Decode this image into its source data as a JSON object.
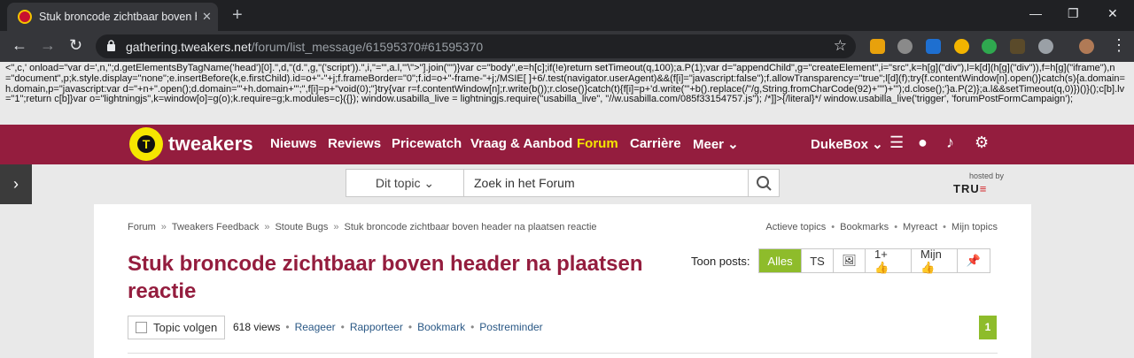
{
  "browser": {
    "tab_title": "Stuk broncode zichtbaar boven h",
    "tab_close": "✕",
    "new_tab": "+",
    "window_controls": [
      "—",
      "❐",
      "✕"
    ],
    "url_host": "gathering.tweakers.net",
    "url_path": "/forum/list_message/61595370#61595370",
    "back": "←",
    "forward": "→",
    "reload": "↻",
    "star": "☆",
    "extensions": [
      "download-icon",
      "abp-icon",
      "bookmark-icon",
      "chrome-icon",
      "translate-icon",
      "dark-icon",
      "chat-icon",
      "avatar-icon",
      "menu-icon"
    ],
    "menu": "⋮"
  },
  "leaked_code": "<\",c,' onload=\"var d=',n,\";d.getElementsByTagName('head')[0].\",d,\"(d.\",g,\"('script')).\",i,\"='\",a.l,\"'\\\">\"].join(\"\")}var c=\"body\",e=h[c];if(!e)return setTimeout(q,100);a.P(1);var d=\"appendChild\",g=\"createElement\",i=\"src\",k=h[g](\"div\"),l=k[d](h[g](\"div\")),f=h[g](\"iframe\"),n=\"document\",p;k.style.display=\"none\";e.insertBefore(k,e.firstChild).id=o+\"-\"+j;f.frameBorder=\"0\";f.id=o+\"-frame-\"+j;/MSIE[ ]+6/.test(navigator.userAgent)&&(f[i]=\"javascript:false\");f.allowTransparency=\"true\";l[d](f);try{f.contentWindow[n].open()}catch(s){a.domain=h.domain,p=\"javascript:var d=\"+n+\".open();d.domain='\"+h.domain+\"';\",f[i]=p+\"void(0);\"}try{var r=f.contentWindow[n];r.write(b());r.close()}catch(t){f[i]=p+'d.write(\"'+b().replace(/\"/g,String.fromCharCode(92)+'\"')+'\");d.close();'}a.P(2)};a.l&&setTimeout(q,0)})()}();c[b].lv=\"1\";return c[b]}var o=\"lightningjs\",k=window[o]=g(o);k.require=g;k.modules=c}({}); window.usabilla_live = lightningjs.require(\"usabilla_live\", \"//w.usabilla.com/085f33154757.js\"); /*]]>{/literal}*/ window.usabilla_live('trigger', 'forumPostFormCampaign');",
  "site": {
    "logo_text": "tweakers",
    "logo_glyph": "T",
    "nav": [
      "Nieuws",
      "Reviews",
      "Pricewatch",
      "Vraag & Aanbod",
      "Forum",
      "Carrière",
      "Meer ⌄"
    ],
    "user": "DukeBox ⌄",
    "colors": {
      "brand": "#941d3e",
      "accent": "#8ebc2b",
      "logo": "#f5e600"
    }
  },
  "search": {
    "scope": "Dit topic ⌄",
    "placeholder": "Zoek in het Forum",
    "hosted_by": "hosted by",
    "host_logo_a": "TRU",
    "host_logo_b": "≡"
  },
  "sidebar": {
    "toggle": "›"
  },
  "topic": {
    "breadcrumbs": [
      "Forum",
      "Tweakers Feedback",
      "Stoute Bugs",
      "Stuk broncode zichtbaar boven header na plaatsen reactie"
    ],
    "breadcrumb_sep": "»",
    "top_links": [
      "Actieve topics",
      "Bookmarks",
      "Myreact",
      "Mijn topics"
    ],
    "title": "Stuk broncode zichtbaar boven header na plaatsen reactie",
    "toon_posts_label": "Toon posts:",
    "filters": [
      "Alles",
      "TS",
      "🖼",
      "1+ 👍",
      "Mijn 👍",
      "📌"
    ],
    "follow_label": "Topic volgen",
    "views": "618 views",
    "actions": [
      "Reageer",
      "Rapporteer",
      "Bookmark",
      "Postreminder"
    ],
    "page": "1"
  }
}
